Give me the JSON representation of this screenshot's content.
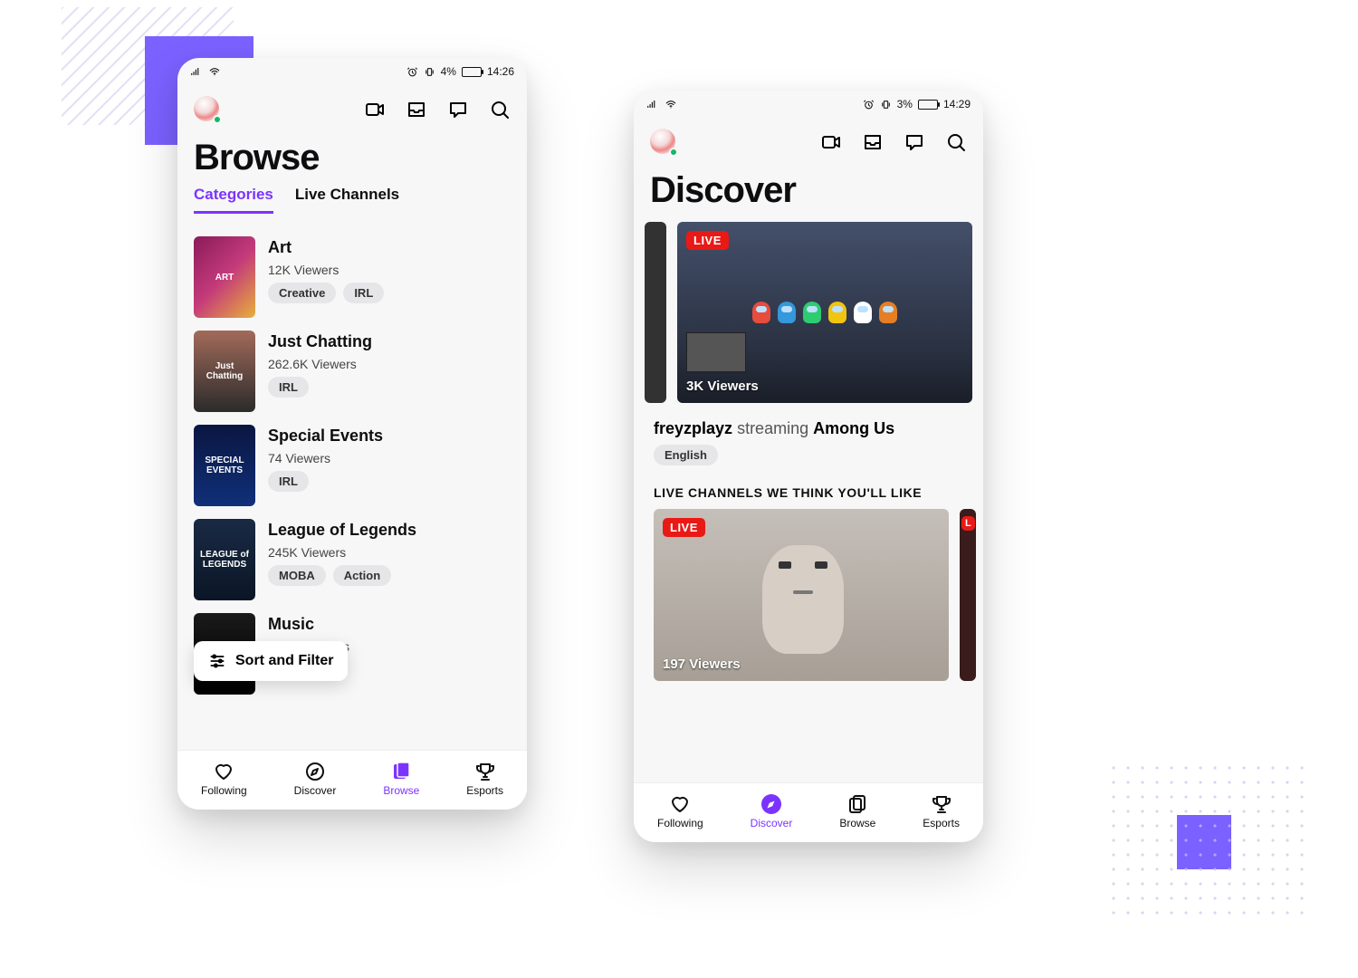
{
  "decorations": {
    "accent_color": "#7b61ff"
  },
  "browse_phone": {
    "status": {
      "battery_pct": "4%",
      "time": "14:26"
    },
    "page_title": "Browse",
    "tabs": {
      "categories": "Categories",
      "live_channels": "Live Channels"
    },
    "categories": [
      {
        "title": "Art",
        "viewers": "12K Viewers",
        "tags": [
          "Creative",
          "IRL"
        ],
        "thumb_label": "ART",
        "thumb_gradient": "linear-gradient(135deg,#8a1b5a,#c43a7b,#e8b03a)"
      },
      {
        "title": "Just Chatting",
        "viewers": "262.6K Viewers",
        "tags": [
          "IRL"
        ],
        "thumb_label": "Just Chatting",
        "thumb_gradient": "linear-gradient(180deg,#a26b5a,#2b2b2b)"
      },
      {
        "title": "Special Events",
        "viewers": "74 Viewers",
        "tags": [
          "IRL"
        ],
        "thumb_label": "SPECIAL EVENTS",
        "thumb_gradient": "linear-gradient(180deg,#0a1640,#10307a)"
      },
      {
        "title": "League of Legends",
        "viewers": "245K Viewers",
        "tags": [
          "MOBA",
          "Action"
        ],
        "thumb_label": "LEAGUE of LEGENDS",
        "thumb_gradient": "linear-gradient(180deg,#1a2a44,#0a1626)"
      },
      {
        "title": "Music",
        "viewers": "38.4K Viewers",
        "tags": [],
        "thumb_label": "",
        "thumb_gradient": "linear-gradient(180deg,#1a1a1a,#000)"
      }
    ],
    "sort_filter_label": "Sort and Filter",
    "nav": {
      "following": "Following",
      "discover": "Discover",
      "browse": "Browse",
      "esports": "Esports"
    }
  },
  "discover_phone": {
    "status": {
      "battery_pct": "3%",
      "time": "14:29"
    },
    "page_title": "Discover",
    "hero": {
      "live_label": "LIVE",
      "viewers": "3K Viewers",
      "streamer": "freyzplayz",
      "verb": "streaming",
      "game": "Among Us",
      "lang_tag": "English"
    },
    "section_header": "LIVE CHANNELS WE THINK YOU'LL LIKE",
    "rec": {
      "live_label": "LIVE",
      "viewers": "197 Viewers"
    },
    "nav": {
      "following": "Following",
      "discover": "Discover",
      "browse": "Browse",
      "esports": "Esports"
    }
  }
}
